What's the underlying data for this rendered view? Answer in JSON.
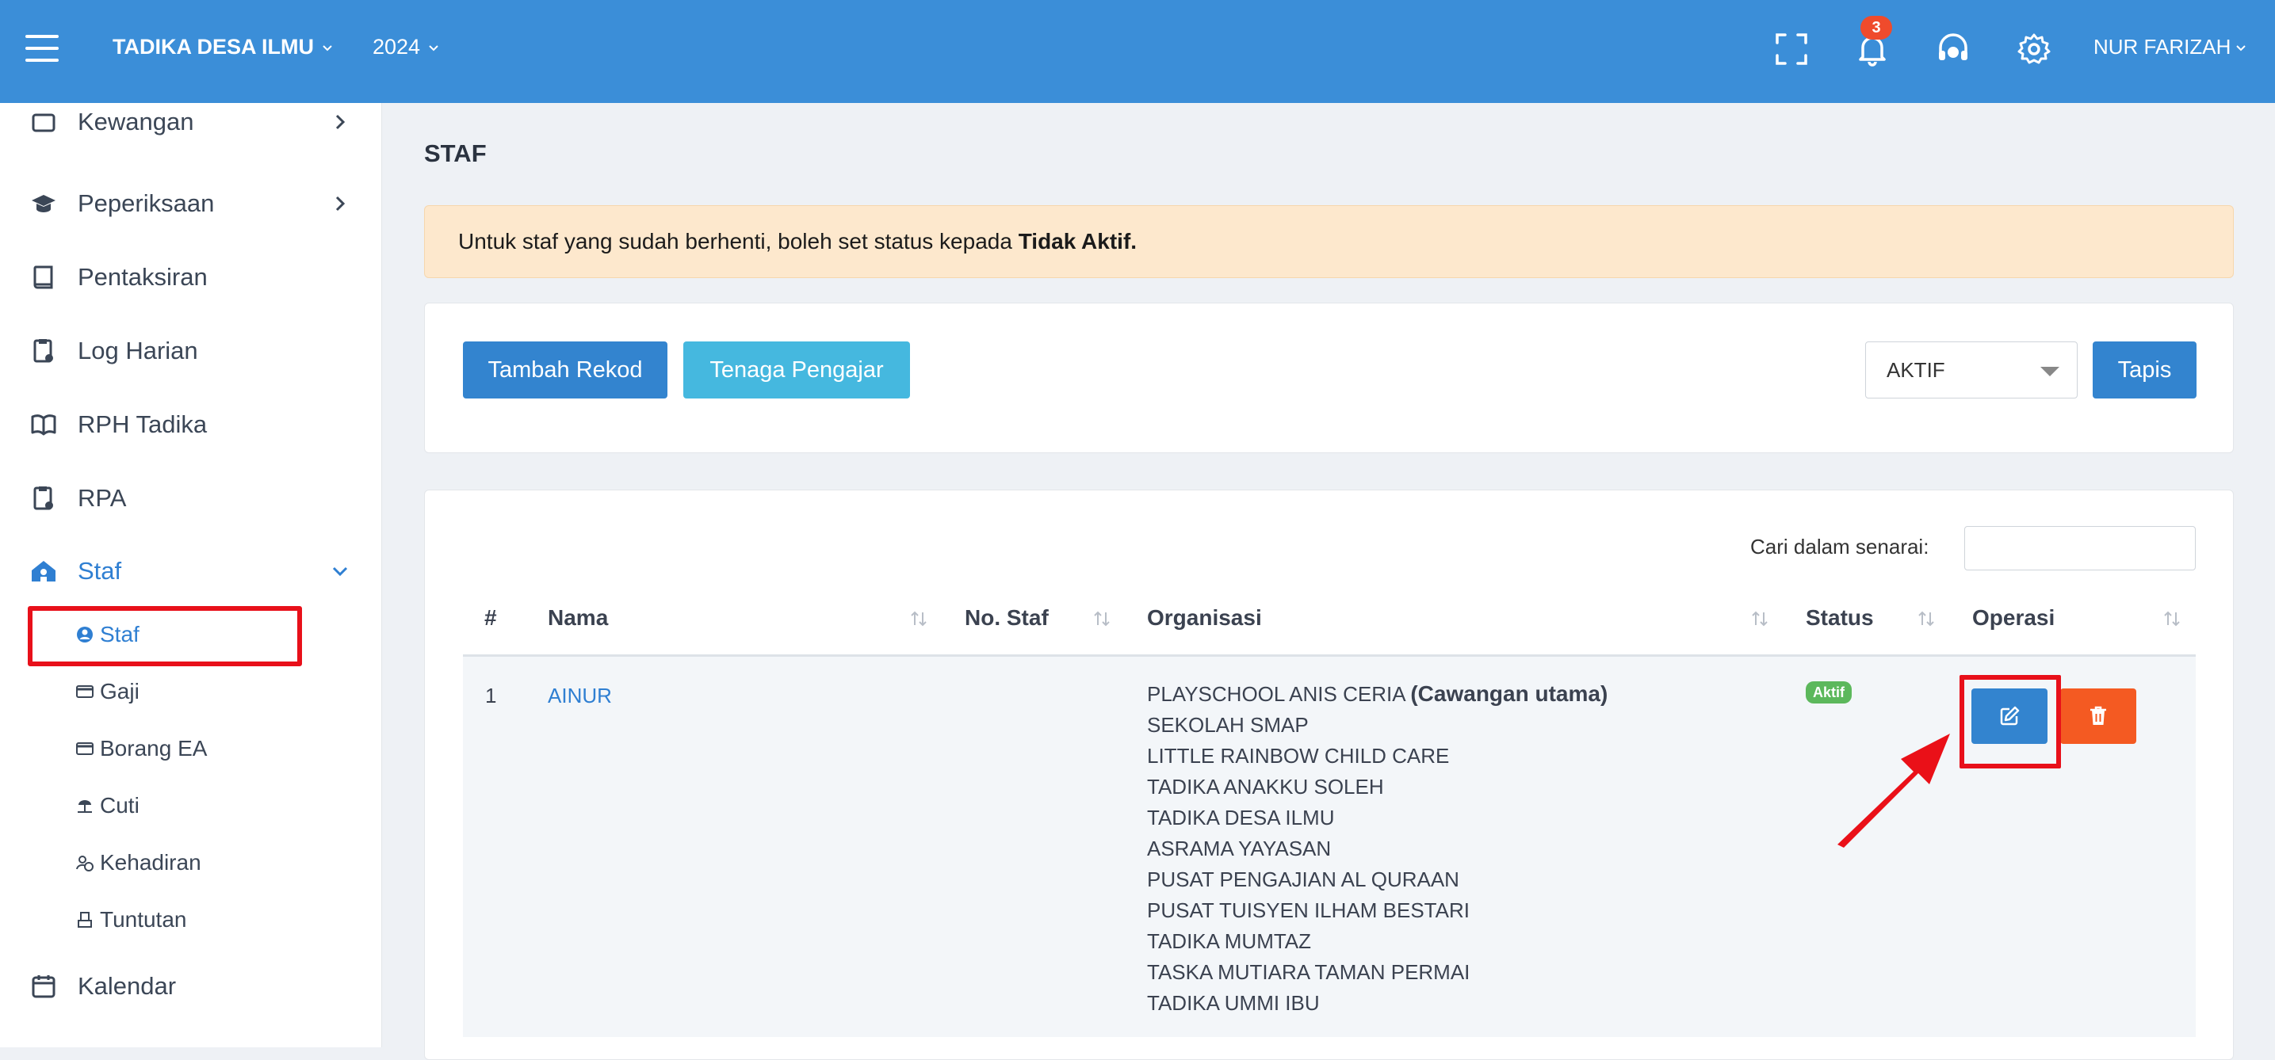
{
  "header": {
    "school": "TADIKA DESA ILMU",
    "year": "2024",
    "notification_count": "3",
    "user": "NUR FARIZAH",
    "icons": [
      "menu-icon",
      "fullscreen-icon",
      "bell-icon",
      "support-headset-icon",
      "gear-icon"
    ],
    "bg_color": "#3b8ed8"
  },
  "sidebar": {
    "items": [
      {
        "label": "Kewangan",
        "icon": "wallet-icon"
      },
      {
        "label": "Peperiksaan",
        "icon": "graduation-cap-icon"
      },
      {
        "label": "Pentaksiran",
        "icon": "book-icon"
      },
      {
        "label": "Log Harian",
        "icon": "clipboard-icon"
      },
      {
        "label": "RPH Tadika",
        "icon": "open-book-icon"
      },
      {
        "label": "RPA",
        "icon": "clipboard-icon"
      },
      {
        "label": "Staf",
        "icon": "school-icon"
      },
      {
        "label": "Kalendar",
        "icon": "calendar-icon"
      }
    ],
    "staf_submenu": [
      {
        "label": "Staf",
        "icon": "user-circle-icon"
      },
      {
        "label": "Gaji",
        "icon": "card-icon"
      },
      {
        "label": "Borang EA",
        "icon": "card-icon"
      },
      {
        "label": "Cuti",
        "icon": "beach-icon"
      },
      {
        "label": "Kehadiran",
        "icon": "user-clock-icon"
      },
      {
        "label": "Tuntutan",
        "icon": "claim-icon"
      }
    ],
    "active_color": "#2f7fd2"
  },
  "page": {
    "title": "STAF",
    "alert_text": "Untuk staf yang sudah berhenti, boleh set status kepada ",
    "alert_bold": "Tidak Aktif."
  },
  "toolbar": {
    "add_label": "Tambah Rekod",
    "teacher_label": "Tenaga Pengajar",
    "status_filter": "AKTIF",
    "filter_label": "Tapis"
  },
  "table": {
    "search_label": "Cari dalam senarai:",
    "search_value": "",
    "headers": [
      "#",
      "Nama",
      "No. Staf",
      "Organisasi",
      "Status",
      "Operasi"
    ],
    "rows": [
      {
        "num": "1",
        "name": "AINUR",
        "staff_no": "",
        "org_main": "PLAYSCHOOL ANIS CERIA",
        "org_main_note": "(Cawangan utama)",
        "orgs": [
          "SEKOLAH SMAP",
          "LITTLE RAINBOW CHILD CARE",
          "TADIKA ANAKKU SOLEH",
          "TADIKA DESA ILMU",
          "ASRAMA YAYASAN",
          "PUSAT PENGAJIAN AL QURAAN",
          "PUSAT TUISYEN ILHAM BESTARI",
          "TADIKA MUMTAZ",
          "TASKA MUTIARA TAMAN PERMAI",
          "TADIKA UMMI IBU"
        ],
        "status": "Aktif"
      }
    ]
  },
  "colors": {
    "primary": "#3384cf",
    "info": "#45b8df",
    "danger": "#f45a22",
    "success": "#5cb85c",
    "highlight": "#e8101a"
  }
}
